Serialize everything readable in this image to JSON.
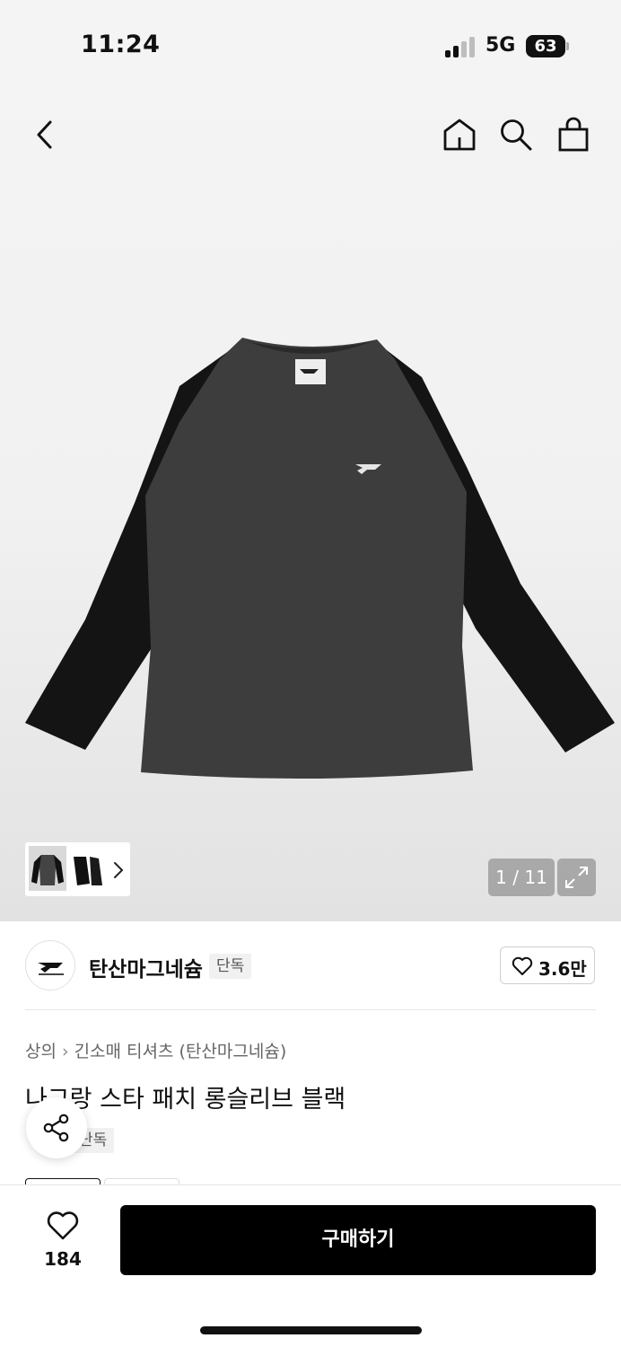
{
  "status_bar": {
    "time": "11:24",
    "network": "5G",
    "battery": "63"
  },
  "nav": {
    "back_icon": "chevron-left-icon",
    "home_icon": "home-icon",
    "search_icon": "search-icon",
    "cart_icon": "shopping-bag-icon"
  },
  "gallery": {
    "image": "raglan-long-sleeve-tshirt",
    "counter": "1 / 11",
    "thumbnails_icon": "chevron-right-icon",
    "expand_icon": "expand-icon"
  },
  "brand": {
    "name": "탄산마그네슘",
    "badge": "단독",
    "like_count": "3.6만"
  },
  "product": {
    "breadcrumb": [
      "상의",
      "긴소매 티셔츠 (탄산마그네슘)"
    ],
    "title": "나그랑 스타 패치 롱슬리브 블랙",
    "badge": "단독"
  },
  "bottom_bar": {
    "wish_count": "184",
    "buy_label": "구매하기"
  },
  "colors": {
    "accent": "#000000",
    "background": "#ffffff",
    "hero_bg": "#f1f1f1"
  }
}
